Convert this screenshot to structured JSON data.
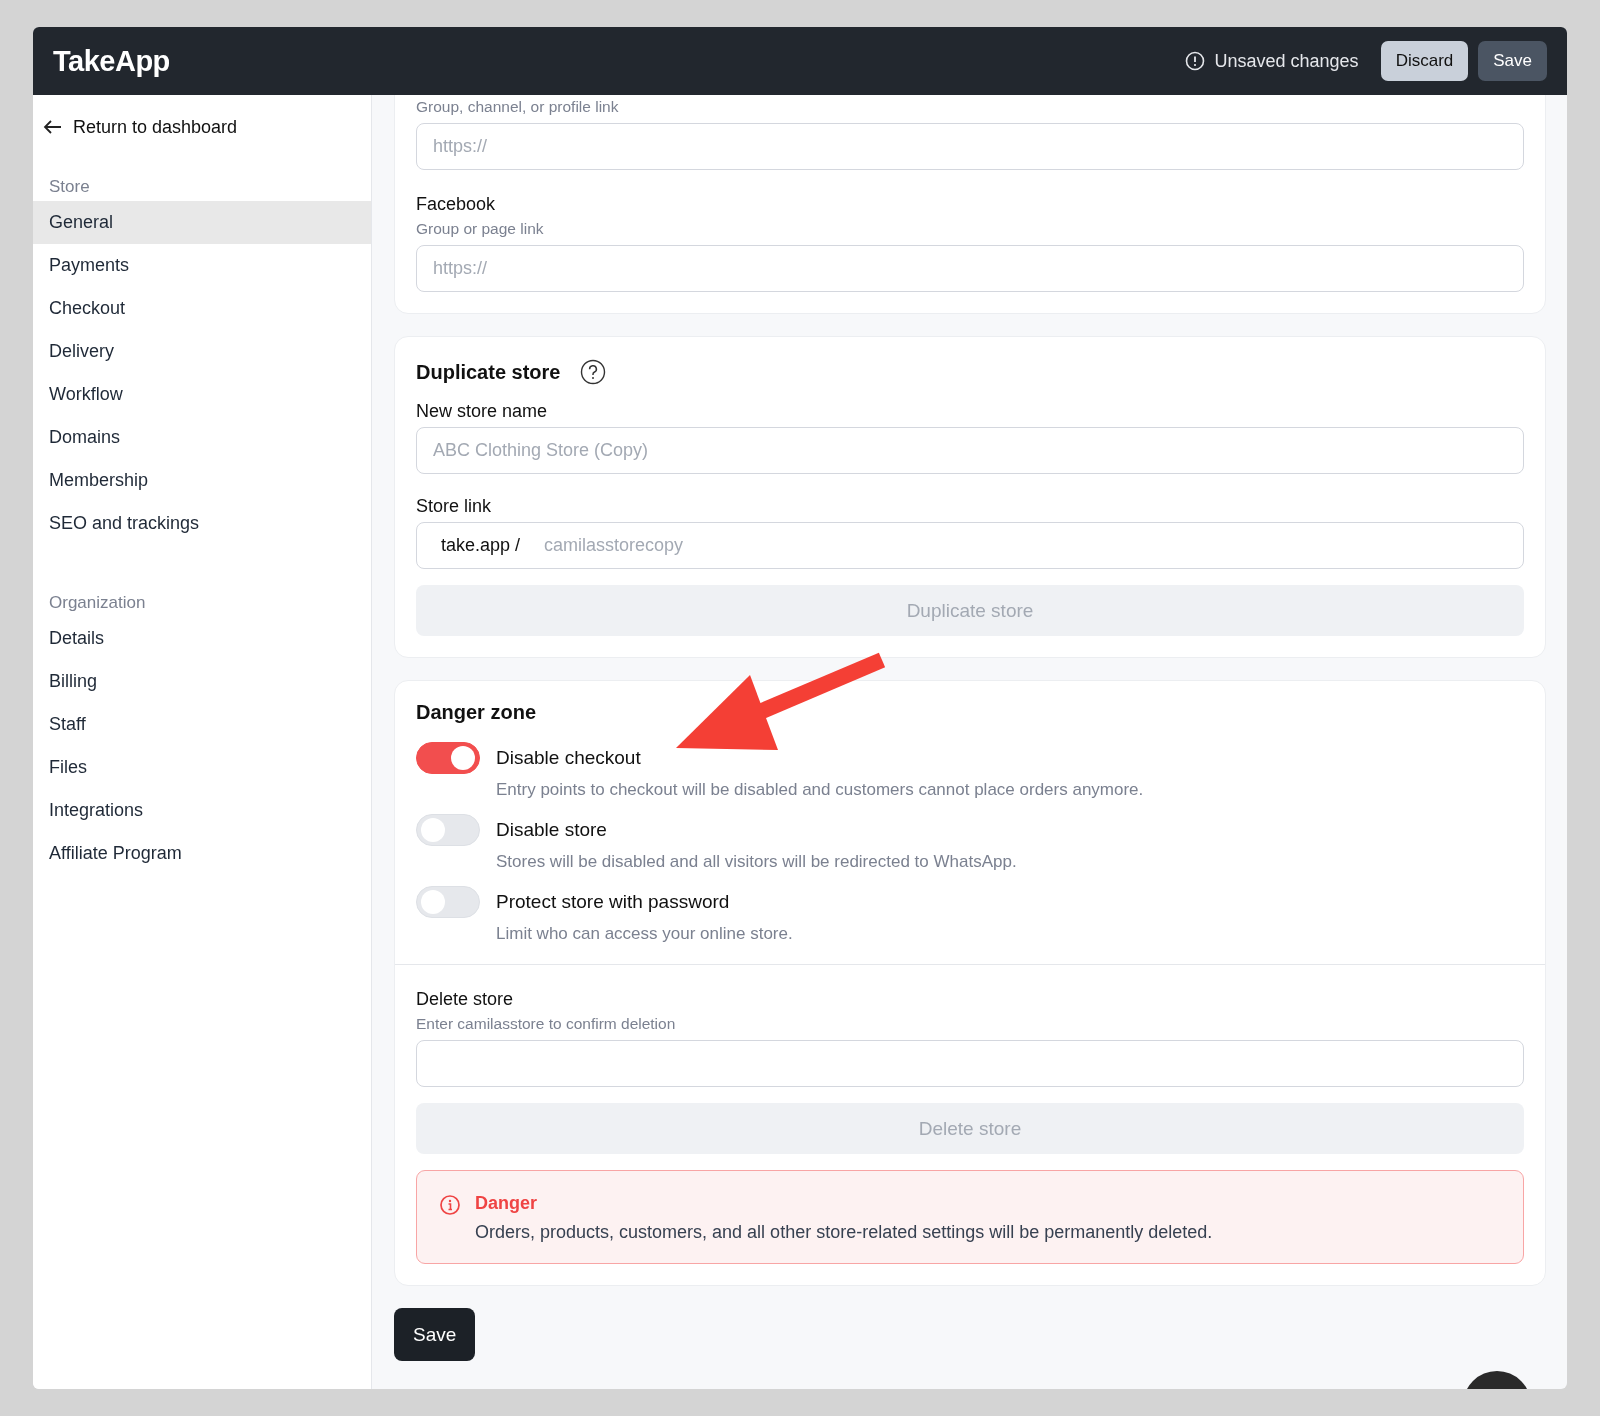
{
  "header": {
    "logo": "TakeApp",
    "status": "Unsaved changes",
    "buttons": [
      {
        "label": "Discard",
        "kind": "secondary"
      },
      {
        "label": "Save",
        "kind": "primary"
      }
    ]
  },
  "sidebar": {
    "back_link": "Return to dashboard",
    "sections": [
      {
        "title": "Store",
        "items": [
          {
            "label": "General",
            "selected": true
          },
          {
            "label": "Payments",
            "selected": false
          },
          {
            "label": "Checkout",
            "selected": false
          },
          {
            "label": "Delivery",
            "selected": false
          },
          {
            "label": "Workflow",
            "selected": false
          },
          {
            "label": "Domains",
            "selected": false
          },
          {
            "label": "Membership",
            "selected": false
          },
          {
            "label": "SEO and trackings",
            "selected": false
          }
        ]
      },
      {
        "title": "Organization",
        "items": [
          {
            "label": "Details",
            "selected": false
          },
          {
            "label": "Billing",
            "selected": false
          },
          {
            "label": "Staff",
            "selected": false
          },
          {
            "label": "Files",
            "selected": false
          },
          {
            "label": "Integrations",
            "selected": false
          },
          {
            "label": "Affiliate Program",
            "selected": false
          }
        ]
      }
    ]
  },
  "links_card": {
    "fields": [
      {
        "hint": "Group, channel, or profile link",
        "placeholder": "https://"
      },
      {
        "label": "Facebook",
        "hint": "Group or page link",
        "placeholder": "https://"
      }
    ]
  },
  "duplicate_card": {
    "title": "Duplicate store",
    "new_name": {
      "label": "New store name",
      "placeholder": "ABC Clothing Store (Copy)"
    },
    "store_link": {
      "label": "Store link",
      "prefix": "take.app /",
      "placeholder": "camilasstorecopy"
    },
    "button": {
      "label": "Duplicate store",
      "disabled": true
    }
  },
  "danger_card": {
    "title": "Danger zone",
    "toggles": [
      {
        "label": "Disable checkout",
        "description": "Entry points to checkout will be disabled and customers cannot place orders anymore.",
        "on": true
      },
      {
        "label": "Disable store",
        "description": "Stores will be disabled and all visitors will be redirected to WhatsApp.",
        "on": false
      },
      {
        "label": "Protect store with password",
        "description": "Limit who can access your online store.",
        "on": false
      }
    ],
    "delete": {
      "label": "Delete store",
      "hint": "Enter camilasstore to confirm deletion",
      "button": {
        "label": "Delete store",
        "disabled": true
      }
    },
    "alert": {
      "title": "Danger",
      "message": "Orders, products, customers, and all other store-related settings will be permanently deleted."
    }
  },
  "save_button": "Save"
}
